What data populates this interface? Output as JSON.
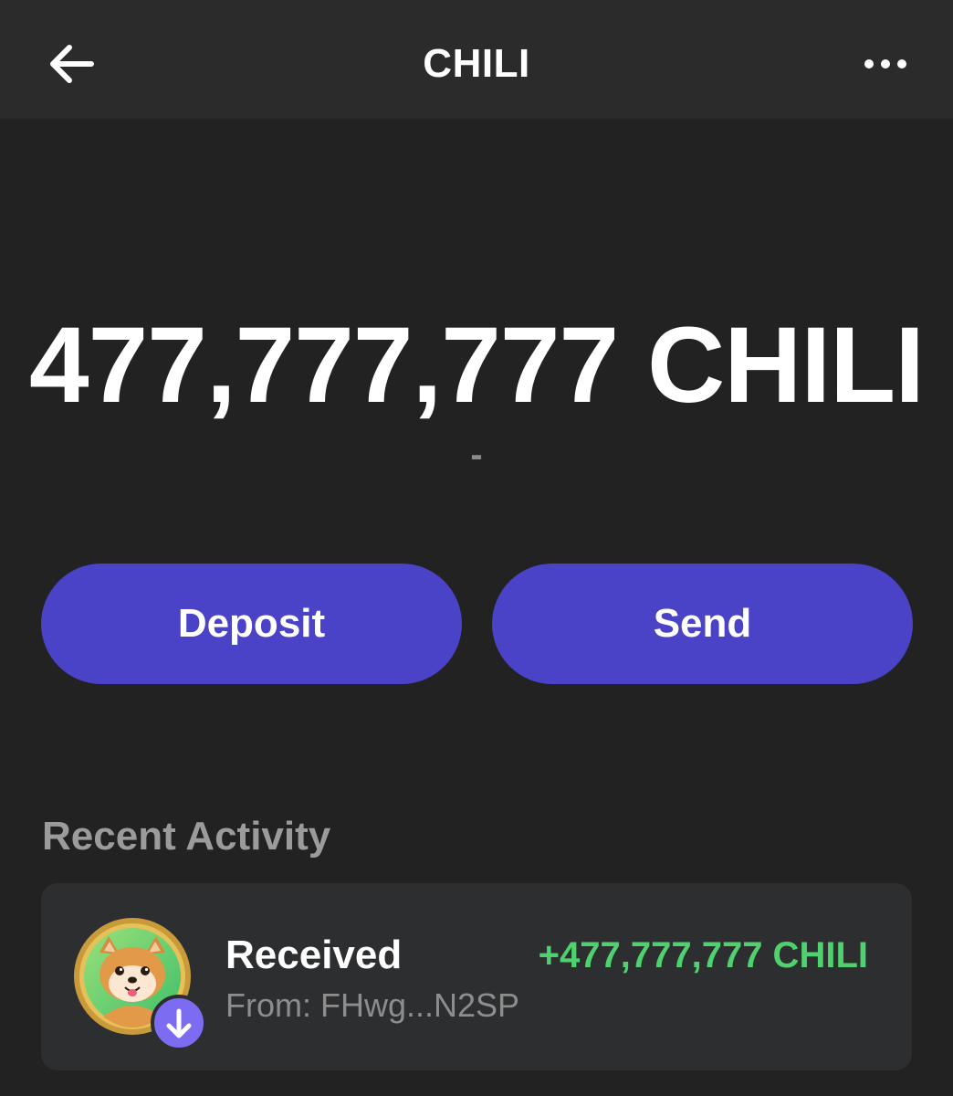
{
  "header": {
    "title": "CHILI",
    "back_icon": "arrow-left-icon",
    "more_icon": "more-horizontal-icon"
  },
  "balance": {
    "amount": "477,777,777 CHILI",
    "fiat": "-"
  },
  "actions": {
    "deposit_label": "Deposit",
    "send_label": "Send"
  },
  "recent_activity": {
    "title": "Recent Activity",
    "items": [
      {
        "type": "Received",
        "from": "From: FHwg...N2SP",
        "amount": "+477,777,777 CHILI",
        "icon": "shiba-dog-token-icon",
        "badge_icon": "arrow-down-icon"
      }
    ]
  },
  "colors": {
    "background": "#222222",
    "header_background": "#2b2b2b",
    "button": "#4a43c7",
    "positive": "#4fd170",
    "muted": "#8d8d8d",
    "card": "#2d2e30",
    "badge": "#7b6cf2"
  }
}
